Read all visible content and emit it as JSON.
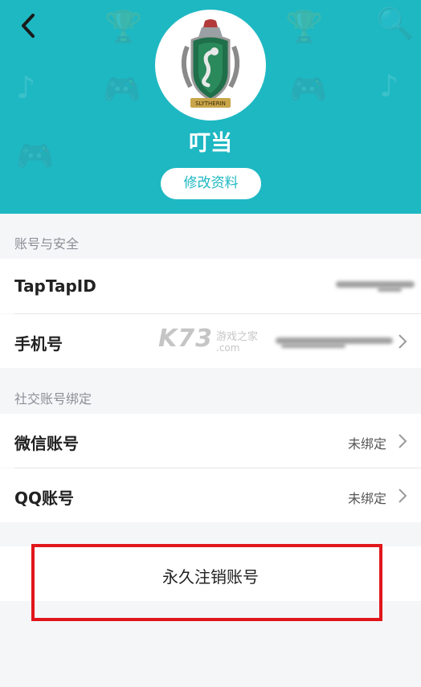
{
  "header": {
    "username": "叮当",
    "edit_button": "修改资料",
    "accent_color": "#1eb8c3",
    "avatar_text": "SLYTHERIN"
  },
  "account_security": {
    "section_title": "账号与安全",
    "rows": [
      {
        "label": "TapTapID",
        "value": "(obscured)",
        "icon": "none"
      },
      {
        "label": "手机号",
        "value": "(obscured)",
        "icon": "chevron-right-icon"
      }
    ]
  },
  "social_binding": {
    "section_title": "社交账号绑定",
    "rows": [
      {
        "label": "微信账号",
        "value": "未绑定",
        "icon": "chevron-right-icon"
      },
      {
        "label": "QQ账号",
        "value": "未绑定",
        "icon": "chevron-right-icon"
      }
    ]
  },
  "cancel_account": {
    "label": "永久注销账号",
    "highlight_color": "#e0161b"
  },
  "watermark": {
    "logo": "K73",
    "cn": "游戏之家",
    "domain": ".com"
  }
}
